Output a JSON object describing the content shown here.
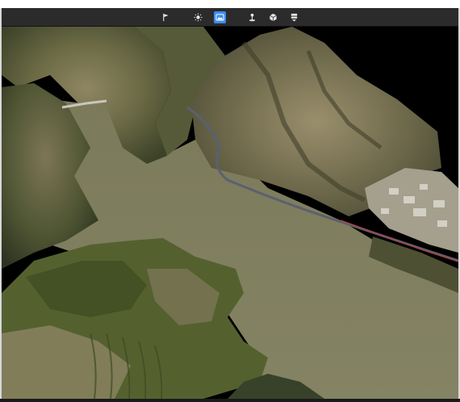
{
  "toolbar": {
    "tools": [
      {
        "icon": "flag-icon",
        "active": false
      },
      {
        "icon": "sun-icon",
        "active": false
      },
      {
        "icon": "image-layer-icon",
        "active": true
      },
      {
        "icon": "person-pin-icon",
        "active": false
      },
      {
        "icon": "cube-icon",
        "active": false
      },
      {
        "icon": "stack-icon",
        "active": false
      }
    ]
  },
  "colors": {
    "toolbar_bg": "#2b2b2b",
    "active_tool": "#3d8bf0",
    "water": "#7d7c5e",
    "background": "#000000"
  }
}
